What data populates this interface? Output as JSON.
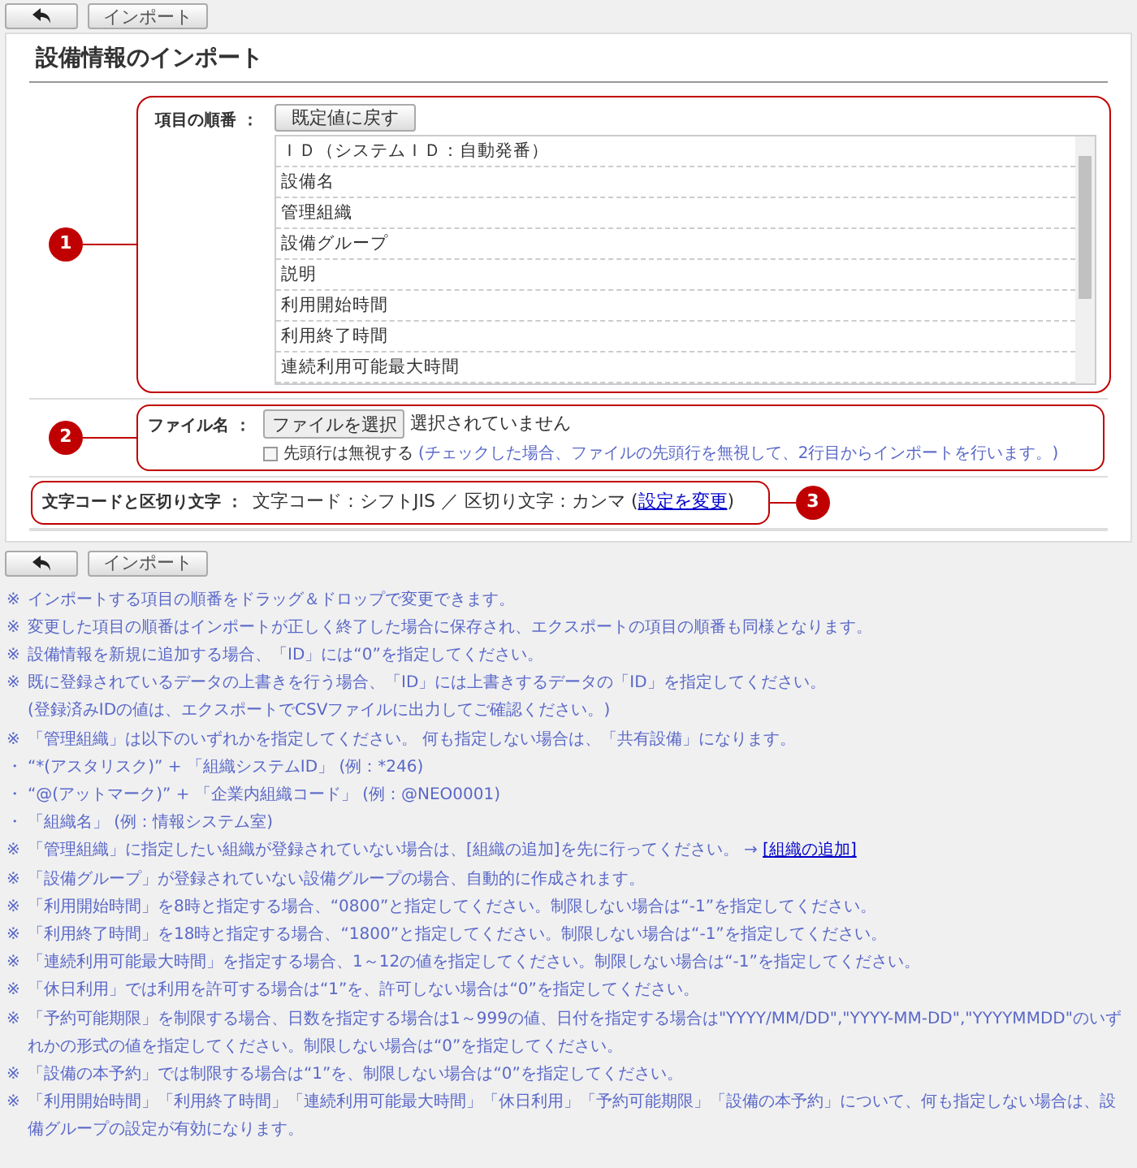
{
  "toolbar_top": {
    "import_button": "インポート"
  },
  "title": "設備情報のインポート",
  "sections": [
    {
      "badge": "1",
      "label": "項目の順番 ：",
      "reset_button": "既定値に戻す",
      "items": [
        "ＩＤ（システムＩＤ：自動発番）",
        "設備名",
        "管理組織",
        "設備グループ",
        "説明",
        "利用開始時間",
        "利用終了時間",
        "連続利用可能最大時間"
      ]
    },
    {
      "badge": "2",
      "label": "ファイル名 ：",
      "file_button": "ファイルを選択",
      "file_status": "選択されていません",
      "skip_header": {
        "label": "先頭行は無視する",
        "checked": false,
        "hint": "(チェックした場合、ファイルの先頭行を無視して、2行目からインポートを行います。)"
      }
    },
    {
      "badge": "3",
      "label": "文字コードと区切り文字 ：",
      "value": "文字コード：シフトJIS ／ 区切り文字：カンマ (",
      "link": "設定を変更",
      "suffix": ")"
    }
  ],
  "toolbar_bottom": {
    "import_button": "インポート"
  },
  "notes": [
    {
      "kind": "note",
      "mark": "※",
      "text": "インポートする項目の順番をドラッグ＆ドロップで変更できます。"
    },
    {
      "kind": "note",
      "mark": "※",
      "text": "変更した項目の順番はインポートが正しく終了した場合に保存され、エクスポートの項目の順番も同様となります。"
    },
    {
      "kind": "note",
      "mark": "※",
      "text": "設備情報を新規に追加する場合、「ID」には“0”を指定してください。"
    },
    {
      "kind": "note",
      "mark": "※",
      "text": "既に登録されているデータの上書きを行う場合、「ID」には上書きするデータの「ID」を指定してください。"
    },
    {
      "kind": "continuation",
      "text": "(登録済みIDの値は、エクスポートでCSVファイルに出力してご確認ください。)"
    },
    {
      "kind": "note",
      "mark": "※",
      "text": "「管理組織」は以下のいずれかを指定してください。 何も指定しない場合は、「共有設備」になります。"
    },
    {
      "kind": "note",
      "mark": "・",
      "text": "“*(アスタリスク)” + 「組織システムID」 (例：*246)"
    },
    {
      "kind": "note",
      "mark": "・",
      "text": "“@(アットマーク)” + 「企業内組織コード」 (例：@NEO0001)"
    },
    {
      "kind": "note",
      "mark": "・",
      "text": "「組織名」 (例：情報システム室)"
    },
    {
      "kind": "note",
      "mark": "※",
      "text": "「管理組織」に指定したい組織が登録されていない場合は、[組織の追加]を先に行ってください。 → ",
      "link": "[組織の追加]"
    },
    {
      "kind": "note",
      "mark": "※",
      "text": "「設備グループ」が登録されていない設備グループの場合、自動的に作成されます。"
    },
    {
      "kind": "note",
      "mark": "※",
      "text": "「利用開始時間」を8時と指定する場合、“0800”と指定してください。制限しない場合は“-1”を指定してください。"
    },
    {
      "kind": "note",
      "mark": "※",
      "text": "「利用終了時間」を18時と指定する場合、“1800”と指定してください。制限しない場合は“-1”を指定してください。"
    },
    {
      "kind": "note",
      "mark": "※",
      "text": "「連続利用可能最大時間」を指定する場合、1～12の値を指定してください。制限しない場合は“-1”を指定してください。"
    },
    {
      "kind": "note",
      "mark": "※",
      "text": "「休日利用」では利用を許可する場合は“1”を、許可しない場合は“0”を指定してください。"
    },
    {
      "kind": "note",
      "mark": "※",
      "text": "「予約可能期限」を制限する場合、日数を指定する場合は1～999の値、日付を指定する場合は\"YYYY/MM/DD\",\"YYYY-MM-DD\",\"YYYYMMDD\"のいずれかの形式の値を指定してください。制限しない場合は“0”を指定してください。"
    },
    {
      "kind": "note",
      "mark": "※",
      "text": "「設備の本予約」では制限する場合は“1”を、制限しない場合は“0”を指定してください。"
    },
    {
      "kind": "note",
      "mark": "※",
      "text": "「利用開始時間」「利用終了時間」「連続利用可能最大時間」「休日利用」「予約可能期限」「設備の本予約」について、何も指定しない場合は、設備グループの設定が有効になります。"
    }
  ]
}
